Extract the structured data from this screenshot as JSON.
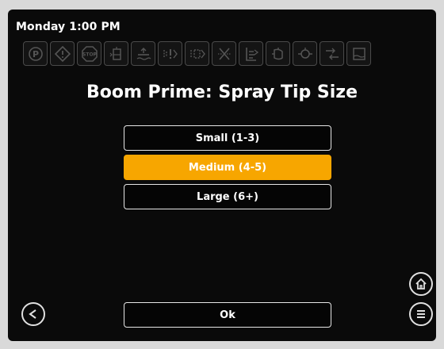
{
  "header": {
    "datetime": "Monday 1:00 PM"
  },
  "status_icons": [
    "park-brake-icon",
    "warning-icon",
    "stop-icon",
    "tank-level-icon",
    "boom-height-icon",
    "boom-section-icon",
    "spray-pattern-icon",
    "nozzle-blocked-icon",
    "boom-fold-icon",
    "pump-icon",
    "filter-icon",
    "flow-meter-icon",
    "tank-icon"
  ],
  "stop_label": "STOP",
  "title": "Boom Prime: Spray Tip Size",
  "options": [
    {
      "label": "Small (1-3)",
      "selected": false
    },
    {
      "label": "Medium (4-5)",
      "selected": true
    },
    {
      "label": "Large (6+)",
      "selected": false
    }
  ],
  "ok_label": "Ok",
  "icons": {
    "back": "back-arrow-icon",
    "home": "home-icon",
    "menu": "menu-icon"
  },
  "colors": {
    "background": "#0a0a0a",
    "selected": "#f7a600",
    "text": "#ffffff"
  }
}
